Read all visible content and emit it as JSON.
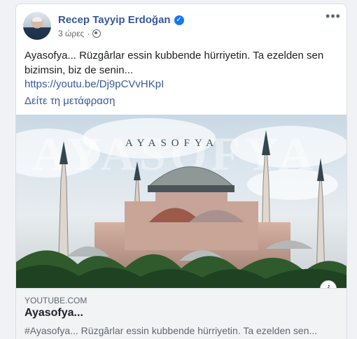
{
  "post": {
    "author": "Recep Tayyip Erdoğan",
    "time": "3 ώρες",
    "separator": "·",
    "text": "Ayasofya... Rüzgârlar essin kubbende hürriyetin. Ta ezelden sen bizimsin, biz de senin...",
    "link": "https://youtu.be/Dj9pCVvHKpI",
    "translate": "Δείτε τη μετάφραση"
  },
  "image": {
    "overlay_title": "AYASOFYA",
    "ghost_text": "AYASOFYA"
  },
  "preview": {
    "domain": "YOUTUBE.COM",
    "title": "Ayasofya...",
    "description": "#Ayasofya... Rüzgârlar essin kubbende hürriyetin. Ta ezelden sen..."
  },
  "icons": {
    "verified": "verified-badge-icon",
    "privacy": "globe-icon",
    "more": "more-options-icon",
    "info": "info-icon"
  },
  "colors": {
    "link": "#385898",
    "verified": "#1877f2",
    "secondary_text": "#65676b"
  }
}
